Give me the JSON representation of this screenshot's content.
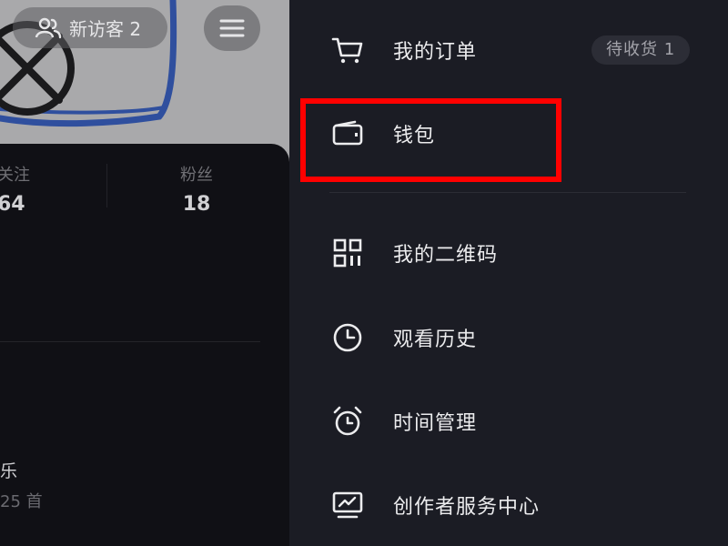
{
  "profile": {
    "visitor_label": "新访客 2",
    "stats": {
      "following": {
        "label": "关注",
        "value": "64"
      },
      "fans": {
        "label": "粉丝",
        "value": "18"
      }
    },
    "music": {
      "title": "乐",
      "count": "25 首"
    }
  },
  "drawer": {
    "items": [
      {
        "label": "我的订单",
        "icon": "cart-icon",
        "badge": "待收货 1"
      },
      {
        "label": "钱包",
        "icon": "wallet-icon"
      },
      {
        "label": "我的二维码",
        "icon": "qrcode-icon"
      },
      {
        "label": "观看历史",
        "icon": "clock-icon"
      },
      {
        "label": "时间管理",
        "icon": "alarm-clock-icon"
      },
      {
        "label": "创作者服务中心",
        "icon": "creator-monitor-icon"
      }
    ]
  },
  "colors": {
    "drawer_background": "#1b1c24",
    "highlight": "#ff0000",
    "badge_background": "#2c2d36"
  }
}
